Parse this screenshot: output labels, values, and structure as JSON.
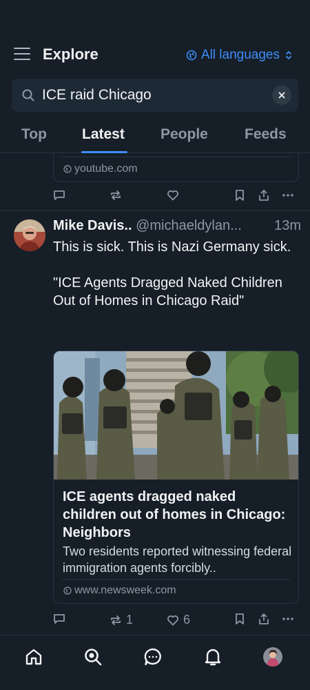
{
  "header": {
    "title": "Explore",
    "language_label": "All languages"
  },
  "search": {
    "value": "ICE raid Chicago",
    "placeholder": "Search"
  },
  "tabs": [
    {
      "label": "Top",
      "active": false
    },
    {
      "label": "Latest",
      "active": true
    },
    {
      "label": "People",
      "active": false
    },
    {
      "label": "Feeds",
      "active": false
    }
  ],
  "previous_post": {
    "link_domain": "youtube.com"
  },
  "post": {
    "author_name": "Mike Davis..",
    "author_handle": "@michaeldylan...",
    "time": "13m",
    "text_lines": [
      "This is sick. This is Nazi Germany sick.",
      "\"ICE Agents Dragged Naked Children Out of Homes in Chicago Raid\""
    ],
    "link_card": {
      "title": "ICE agents dragged naked children out of homes in Chicago: Neighbors",
      "description": "Two residents reported witnessing federal immigration agents forcibly..",
      "domain": "www.newsweek.com"
    },
    "counts": {
      "replies": "",
      "reposts": "1",
      "likes": "6"
    }
  },
  "bottom_nav": [
    {
      "icon": "home-icon"
    },
    {
      "icon": "search-icon",
      "active": true
    },
    {
      "icon": "chat-icon"
    },
    {
      "icon": "bell-icon"
    },
    {
      "icon": "profile-avatar"
    }
  ],
  "colors": {
    "background": "#161e27",
    "accent": "#3d8ef8",
    "muted": "#8d98a5",
    "border": "#2a3441"
  }
}
